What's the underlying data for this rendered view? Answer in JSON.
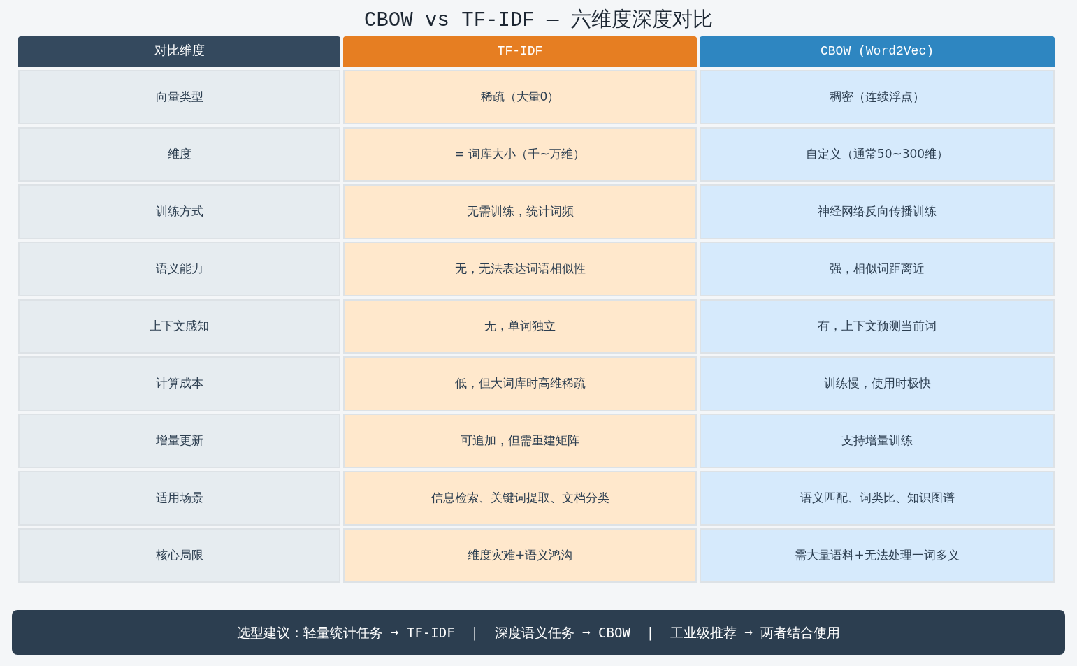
{
  "title": "CBOW vs TF-IDF — 六维度深度对比",
  "columns": [
    {
      "label": "对比维度",
      "kind": "dimension"
    },
    {
      "label": "TF-IDF",
      "kind": "tfidf"
    },
    {
      "label": "CBOW (Word2Vec)",
      "kind": "cbow"
    }
  ],
  "rows": [
    [
      "向量类型",
      "稀疏（大量0）",
      "稠密（连续浮点）"
    ],
    [
      "维度",
      "= 词库大小（千~万维）",
      "自定义（通常50~300维）"
    ],
    [
      "训练方式",
      "无需训练，统计词频",
      "神经网络反向传播训练"
    ],
    [
      "语义能力",
      "无，无法表达词语相似性",
      "强，相似词距离近"
    ],
    [
      "上下文感知",
      "无，单词独立",
      "有，上下文预测当前词"
    ],
    [
      "计算成本",
      "低，但大词库时高维稀疏",
      "训练慢，使用时极快"
    ],
    [
      "增量更新",
      "可追加，但需重建矩阵",
      "支持增量训练"
    ],
    [
      "适用场景",
      "信息检索、关键词提取、文档分类",
      "语义匹配、词类比、知识图谱"
    ],
    [
      "核心局限",
      "维度灾难+语义鸿沟",
      "需大量语料+无法处理一词多义"
    ]
  ],
  "footer": "选型建议：轻量统计任务 ➞ TF-IDF  |  深度语义任务 ➞ CBOW  |  工业级推荐 ➞ 两者结合使用"
}
